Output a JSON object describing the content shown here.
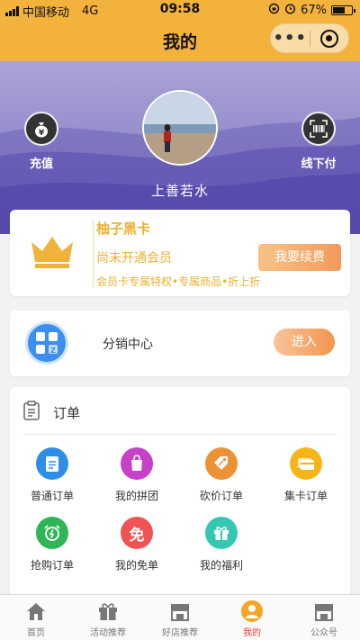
{
  "status_bar": {
    "carrier": "中国移动",
    "network": "4G",
    "time": "09:58",
    "battery_percent": "67%",
    "battery_level": 0.67
  },
  "navbar": {
    "title": "我的"
  },
  "profile": {
    "left_action": "充值",
    "right_action": "线下付",
    "username": "上善若水"
  },
  "vip_card": {
    "name": "柚子黑卡",
    "status": "尚未开通会员",
    "perks": "会员卡专属特权•专属商品•折上折",
    "renew_button": "我要续费"
  },
  "distribution": {
    "label": "分销中心",
    "enter_button": "进入"
  },
  "orders": {
    "title": "订单",
    "items": [
      {
        "label": "普通订单",
        "icon": "clipboard-icon",
        "color": "#2e8de6"
      },
      {
        "label": "我的拼团",
        "icon": "shopping-bag-icon",
        "color": "#c640c8"
      },
      {
        "label": "砍价订单",
        "icon": "price-tag-icon",
        "color": "#ec9234"
      },
      {
        "label": "集卡订单",
        "icon": "cards-icon",
        "color": "#f5b419"
      },
      {
        "label": "抢购订单",
        "icon": "alarm-clock-icon",
        "color": "#2fb457"
      },
      {
        "label": "我的免单",
        "icon": "free-badge-icon",
        "glyph": "免",
        "color": "#f05353"
      },
      {
        "label": "我的福利",
        "icon": "gift-icon",
        "color": "#35c7b4"
      }
    ]
  },
  "tabbar": [
    {
      "label": "首页",
      "icon": "home-icon",
      "active": false
    },
    {
      "label": "活动推荐",
      "icon": "gift-icon",
      "active": false
    },
    {
      "label": "好店推荐",
      "icon": "store-icon",
      "active": false
    },
    {
      "label": "我的",
      "icon": "user-icon",
      "active": true
    },
    {
      "label": "公众号",
      "icon": "store-icon",
      "active": false
    }
  ],
  "colors": {
    "brand": "#f2b23c",
    "gold_text": "#ebb032",
    "active_tab": "#e4393c"
  }
}
